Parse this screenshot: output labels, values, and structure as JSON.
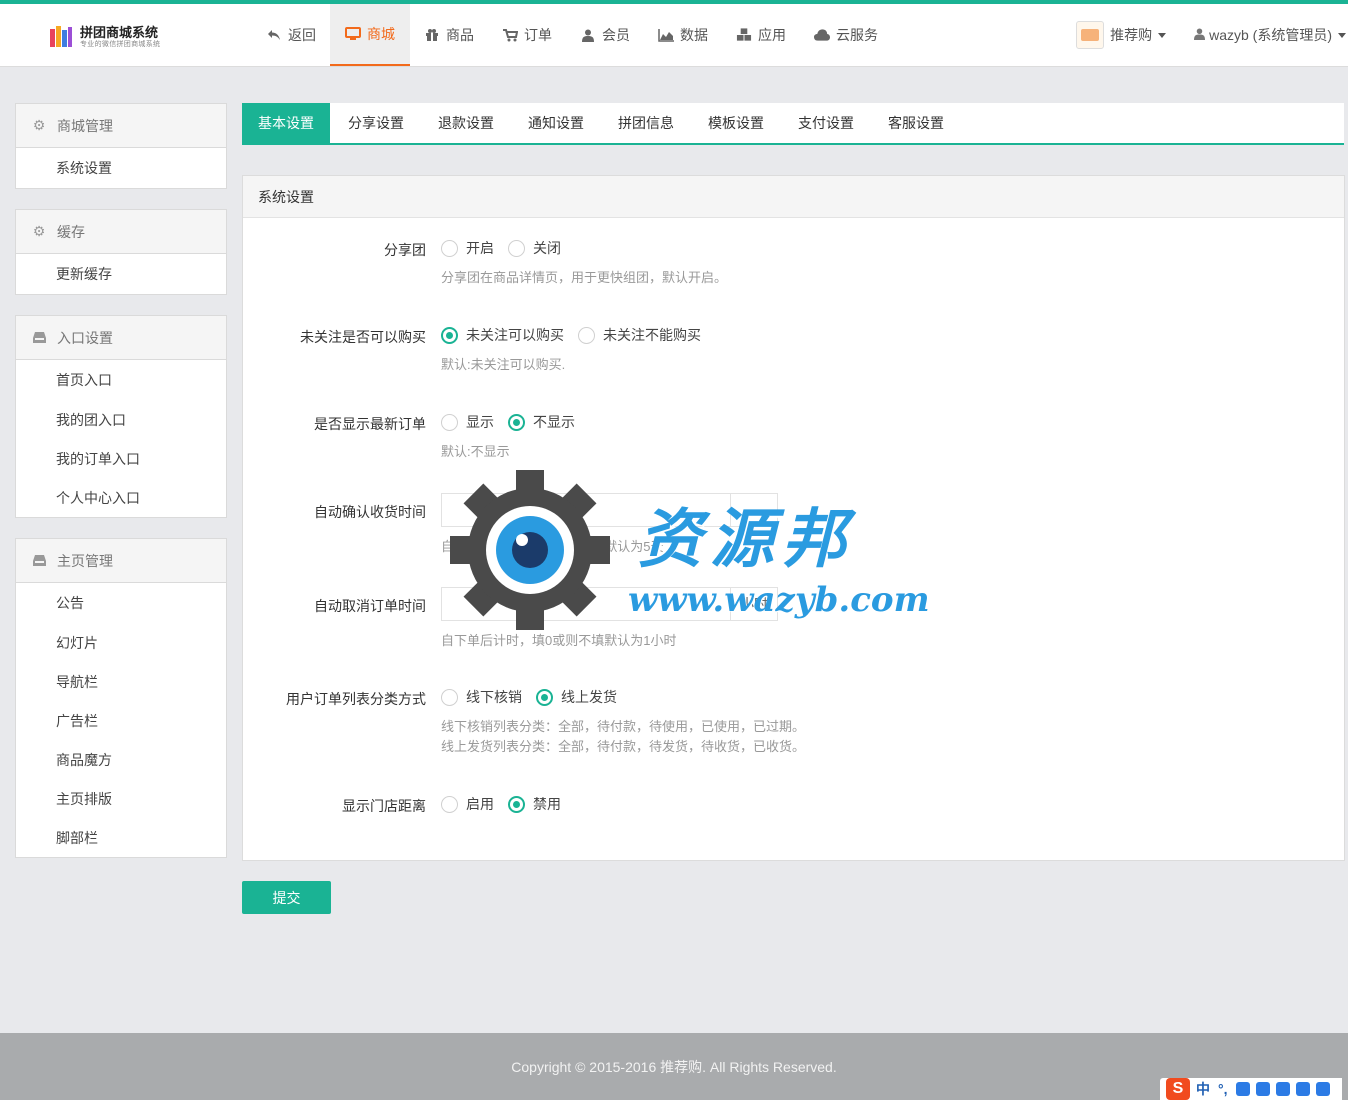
{
  "header": {
    "logo": {
      "title": "拼团商城系统",
      "subtitle": "专业的微信拼团商城系统"
    },
    "nav": [
      {
        "icon": "undo-icon",
        "label": "返回"
      },
      {
        "icon": "monitor-icon",
        "label": "商城",
        "active": true
      },
      {
        "icon": "gift-icon",
        "label": "商品"
      },
      {
        "icon": "cart-icon",
        "label": "订单"
      },
      {
        "icon": "user-icon",
        "label": "会员"
      },
      {
        "icon": "area-chart-icon",
        "label": "数据"
      },
      {
        "icon": "cubes-icon",
        "label": "应用"
      },
      {
        "icon": "cloud-icon",
        "label": "云服务"
      }
    ],
    "shop_name": "推荐购",
    "user_label": "wazyb (系统管理员)"
  },
  "sidebar": {
    "groups": [
      {
        "title": "商城管理",
        "icon": "gear-icon",
        "items": [
          "系统设置"
        ]
      },
      {
        "title": "缓存",
        "icon": "gear-icon",
        "items": [
          "更新缓存"
        ]
      },
      {
        "title": "入口设置",
        "icon": "inbox-icon",
        "items": [
          "首页入口",
          "我的团入口",
          "我的订单入口",
          "个人中心入口"
        ]
      },
      {
        "title": "主页管理",
        "icon": "inbox-icon",
        "items": [
          "公告",
          "幻灯片",
          "导航栏",
          "广告栏",
          "商品魔方",
          "主页排版",
          "脚部栏"
        ]
      }
    ]
  },
  "tabs": [
    "基本设置",
    "分享设置",
    "退款设置",
    "通知设置",
    "拼团信息",
    "模板设置",
    "支付设置",
    "客服设置"
  ],
  "panel": {
    "title": "系统设置",
    "fields": {
      "share_group": {
        "label": "分享团",
        "options": [
          "开启",
          "关闭"
        ],
        "help": "分享团在商品详情页，用于更快组团，默认开启。"
      },
      "follow_buy": {
        "label": "未关注是否可以购买",
        "options": [
          "未关注可以购买",
          "未关注不能购买"
        ],
        "help": "默认:未关注可以购买."
      },
      "latest_order": {
        "label": "是否显示最新订单",
        "options": [
          "显示",
          "不显示"
        ],
        "help": "默认:不显示"
      },
      "auto_confirm": {
        "label": "自动确认收货时间",
        "value": "",
        "unit": "",
        "help": "自发货后计时，填0或则不填默认为5天"
      },
      "auto_cancel": {
        "label": "自动取消订单时间",
        "value": "",
        "unit": "小时",
        "help": "自下单后计时，填0或则不填默认为1小时"
      },
      "order_list_type": {
        "label": "用户订单列表分类方式",
        "options": [
          "线下核销",
          "线上发货"
        ],
        "help": [
          "线下核销列表分类：全部，待付款，待使用，已使用，已过期。",
          "线上发货列表分类：全部，待付款，待发货，待收货，已收货。"
        ]
      },
      "store_distance": {
        "label": "显示门店距离",
        "options": [
          "启用",
          "禁用"
        ]
      }
    },
    "selected": {
      "share_group": null,
      "follow_buy": "未关注可以购买",
      "latest_order": "不显示",
      "order_list_type": "线上发货",
      "store_distance": "禁用"
    }
  },
  "submit_label": "提交",
  "footer": "Copyright © 2015-2016 推荐购. All Rights Reserved.",
  "watermark": {
    "title": "资源邦",
    "url": "www.wazyb.com"
  },
  "ime": {
    "mode": "中",
    "punct": "°,"
  },
  "colors": {
    "accent": "#1ab394",
    "nav_active": "#f26a1b",
    "footer_bg": "#a9abad"
  }
}
